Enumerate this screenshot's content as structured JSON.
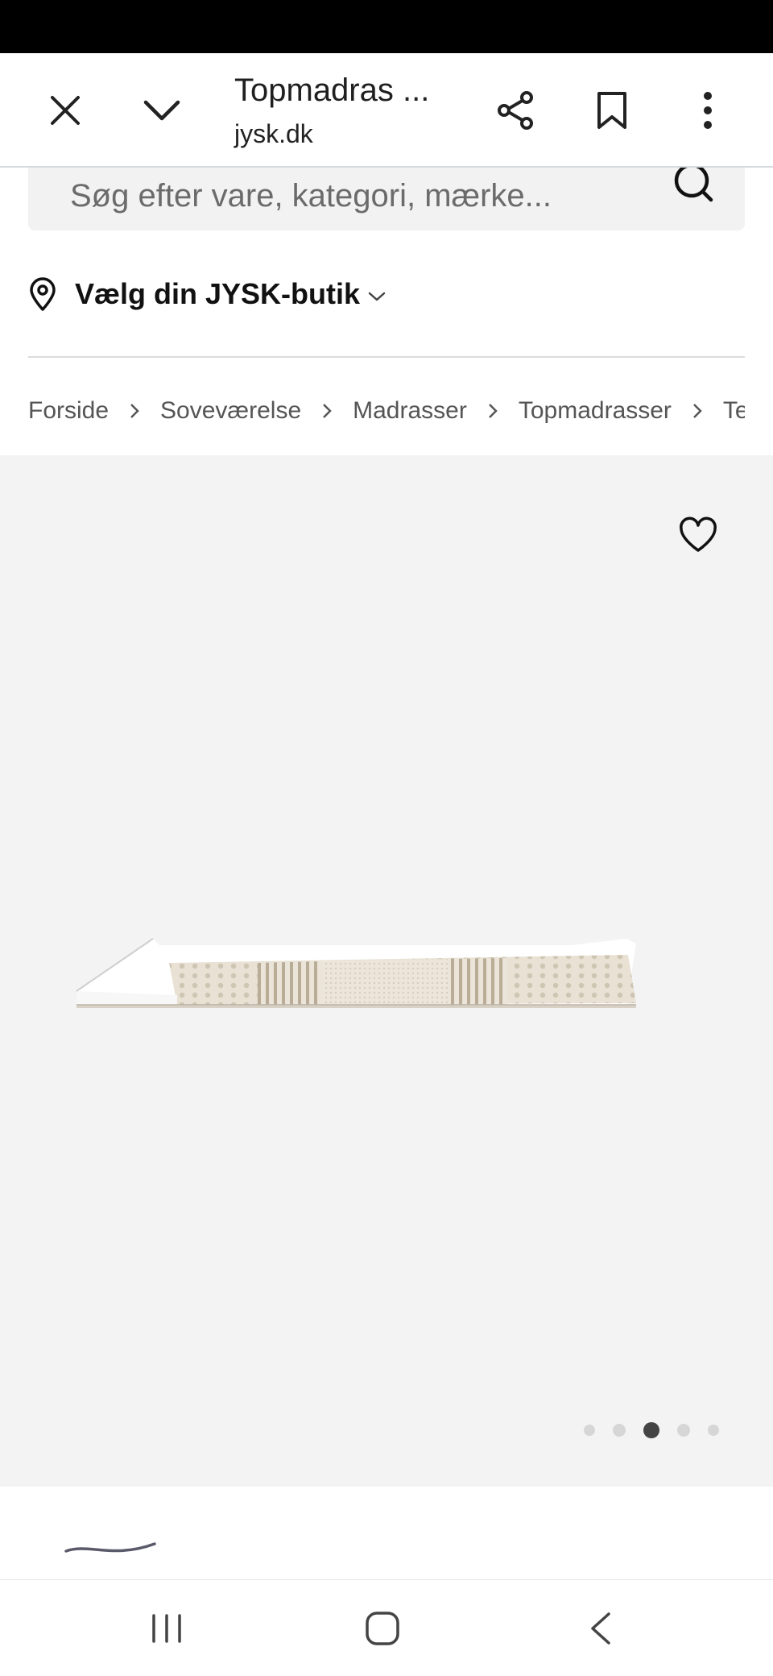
{
  "browser": {
    "title": "Topmadras ...",
    "domain": "jysk.dk",
    "icons": [
      "close-icon",
      "chevron-down-icon",
      "share-icon",
      "bookmark-icon",
      "more-vert-icon"
    ]
  },
  "search": {
    "placeholder": "Søg efter vare, kategori, mærke...",
    "icon": "search-icon"
  },
  "store": {
    "label": "Vælg din JYSK-butik",
    "icon": "location-pin-icon"
  },
  "breadcrumb": {
    "items": [
      "Forside",
      "Soveværelse",
      "Madrasser",
      "Topmadrasser",
      "Te"
    ]
  },
  "gallery": {
    "image_count": 5,
    "active_index": 2,
    "background": "#f3f3f3"
  },
  "colors": {
    "accent_dark": "#444444",
    "foam": "#e8e1d4",
    "cover": "#ffffff"
  }
}
